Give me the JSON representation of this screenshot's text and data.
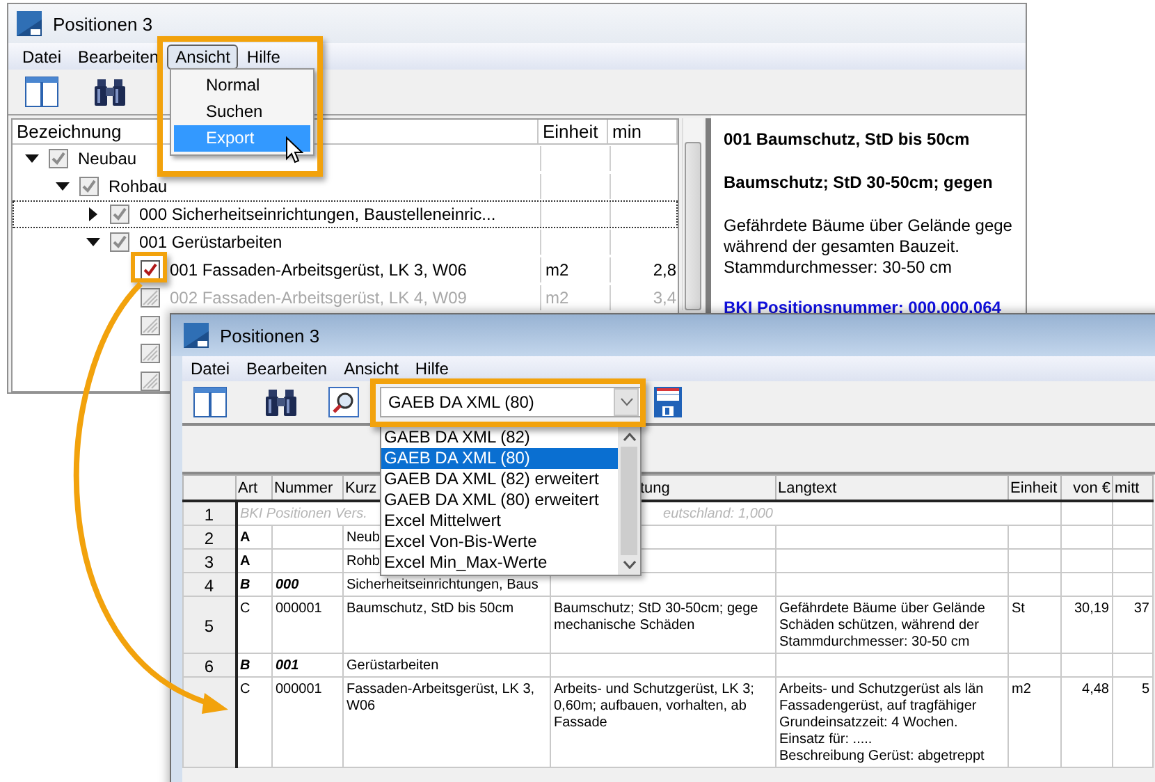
{
  "back_window": {
    "title": "Positionen 3",
    "menu": [
      {
        "label": "Datei",
        "open": false
      },
      {
        "label": "Bearbeiten",
        "open": false
      },
      {
        "label": "Ansicht",
        "open": true
      },
      {
        "label": "Hilfe",
        "open": false
      }
    ],
    "menu_items": [
      {
        "label": "Normal",
        "selected": false
      },
      {
        "label": "Suchen",
        "selected": false
      },
      {
        "label": "Export",
        "selected": true
      }
    ],
    "tree": {
      "columns": [
        "Bezeichnung",
        "Einheit",
        "min"
      ],
      "items": [
        {
          "label": "Neubau",
          "checked": true,
          "locked": true,
          "focused": false,
          "expanded": true,
          "children": [
            {
              "label": "Rohbau",
              "checked": true,
              "locked": true,
              "focused": false,
              "expanded": true,
              "children": [
                {
                  "label": "000 Sicherheitseinrichtungen, Baustelleneinric...",
                  "checked": true,
                  "locked": true,
                  "focused": true,
                  "expanded": false
                },
                {
                  "label": "001 Gerüstarbeiten",
                  "checked": true,
                  "locked": true,
                  "focused": false,
                  "expanded": true,
                  "children": [
                    {
                      "label": "001 Fassaden-Arbeitsgerüst, LK 3, W06",
                      "unit": "m2",
                      "min": "2,8",
                      "checked": true,
                      "locked": false,
                      "focused": false
                    },
                    {
                      "label": "002 Fassaden-Arbeitsgerüst, LK 4, W09",
                      "unit": "m2",
                      "min": "3,4",
                      "checked": false,
                      "locked": true,
                      "focused": false
                    },
                    {
                      "checked": false,
                      "locked": true
                    },
                    {
                      "checked": false,
                      "locked": true
                    },
                    {
                      "checked": false,
                      "locked": true
                    }
                  ]
                }
              ]
            }
          ]
        }
      ]
    },
    "detail": {
      "title": "001 Baumschutz, StD bis 50cm",
      "subtitle": "Baumschutz; StD 30-50cm; gegen",
      "body": "Gefährdete Bäume über Gelände gege\nwährend der gesamten Bauzeit.\nStammdurchmesser: 30-50 cm",
      "link": "BKI Positionsnummer: 000.000.064"
    }
  },
  "front_window": {
    "title": "Positionen 3",
    "menu": [
      "Datei",
      "Bearbeiten",
      "Ansicht",
      "Hilfe"
    ],
    "format": {
      "value": "GAEB DA XML (80)",
      "expanded": true
    },
    "format_options": [
      {
        "label": "GAEB DA XML (82)",
        "selected": false
      },
      {
        "label": "GAEB DA XML (80)",
        "selected": true
      },
      {
        "label": "GAEB DA XML (82) erweitert",
        "selected": false
      },
      {
        "label": "GAEB DA XML (80) erweitert",
        "selected": false
      },
      {
        "label": "Excel Mittelwert",
        "selected": false
      },
      {
        "label": "Excel Von-Bis-Werte",
        "selected": false
      },
      {
        "label": "Excel Min_Max-Werte",
        "selected": false
      }
    ],
    "grid": {
      "columns": [
        "Art",
        "Nummer",
        "Kurz",
        "tung",
        "Langtext",
        "Einheit",
        "von €",
        "mitt"
      ],
      "rows": [
        {
          "number": "1",
          "kind": "info",
          "note": "BKI Positionen Vers.",
          "note_end": "eutschland: 1,000"
        },
        {
          "number": "2",
          "kind": "section",
          "art": "A",
          "kurztext": "Neub"
        },
        {
          "number": "3",
          "kind": "section",
          "art": "A",
          "kurztext": "Rohb"
        },
        {
          "number": "4",
          "kind": "group",
          "art": "B",
          "nummer": "000",
          "kurztext": "Sicherheitseinrichtungen, Baus"
        },
        {
          "number": "5",
          "kind": "position",
          "art": "C",
          "nummer": "000001",
          "kurztext": "Baumschutz, StD bis 50cm",
          "tung": "Baumschutz; StD 30-50cm; gege\nmechanische Schäden",
          "langtext": "Gefährdete Bäume über Gelände\nSchäden schützen, während der\nStammdurchmesser: 30-50 cm",
          "einheit": "St",
          "von": "30,19",
          "mitt": "37"
        },
        {
          "number": "6",
          "kind": "group",
          "art": "B",
          "nummer": "001",
          "kurztext": "Gerüstarbeiten"
        },
        {
          "kind": "position",
          "art": "C",
          "nummer": "000001",
          "kurztext": "Fassaden-Arbeitsgerüst, LK 3, W06",
          "tung": "Arbeits- und Schutzgerüst, LK 3;\n0,60m; aufbauen, vorhalten, ab\nFassade",
          "langtext": "Arbeits- und Schutzgerüst als län\nFassadengerüst, auf tragfähiger\nGrundeinsatzzeit: 4 Wochen.\nEinsatz für: .....\nBeschreibung Gerüst: abgetreppt",
          "einheit": "m2",
          "von": "4,48",
          "mitt": "5"
        }
      ]
    }
  }
}
